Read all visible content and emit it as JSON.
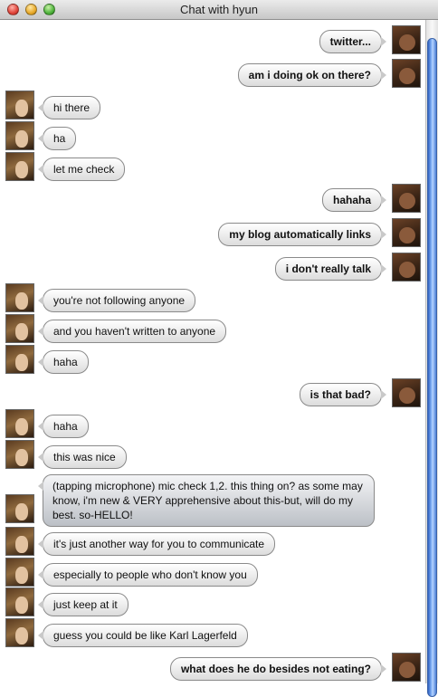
{
  "window": {
    "title": "Chat with hyun"
  },
  "messages": [
    {
      "from": "me",
      "text": "twitter..."
    },
    {
      "from": "me",
      "text": "am i doing ok on there?"
    },
    {
      "from": "hyun",
      "text": "hi there"
    },
    {
      "from": "hyun",
      "text": "ha"
    },
    {
      "from": "hyun",
      "text": "let me check"
    },
    {
      "from": "me",
      "text": "hahaha"
    },
    {
      "from": "me",
      "text": "my blog automatically links"
    },
    {
      "from": "me",
      "text": "i don't really talk"
    },
    {
      "from": "hyun",
      "text": "you're not following anyone"
    },
    {
      "from": "hyun",
      "text": "and you haven't written to anyone"
    },
    {
      "from": "hyun",
      "text": "haha"
    },
    {
      "from": "me",
      "text": "is that bad?"
    },
    {
      "from": "hyun",
      "text": "haha"
    },
    {
      "from": "hyun",
      "text": "this was nice"
    },
    {
      "from": "hyun",
      "text": "(tapping microphone) mic check 1,2. this thing on? as some may know, i'm new & VERY apprehensive about this-but, will do my best. so-HELLO!"
    },
    {
      "from": "hyun",
      "text": "it's just another way for you to communicate"
    },
    {
      "from": "hyun",
      "text": "especially to people who don't know you"
    },
    {
      "from": "hyun",
      "text": "just keep at it"
    },
    {
      "from": "hyun",
      "text": "guess you could be like Karl Lagerfeld"
    },
    {
      "from": "me",
      "text": "what does he do besides not eating?"
    }
  ]
}
